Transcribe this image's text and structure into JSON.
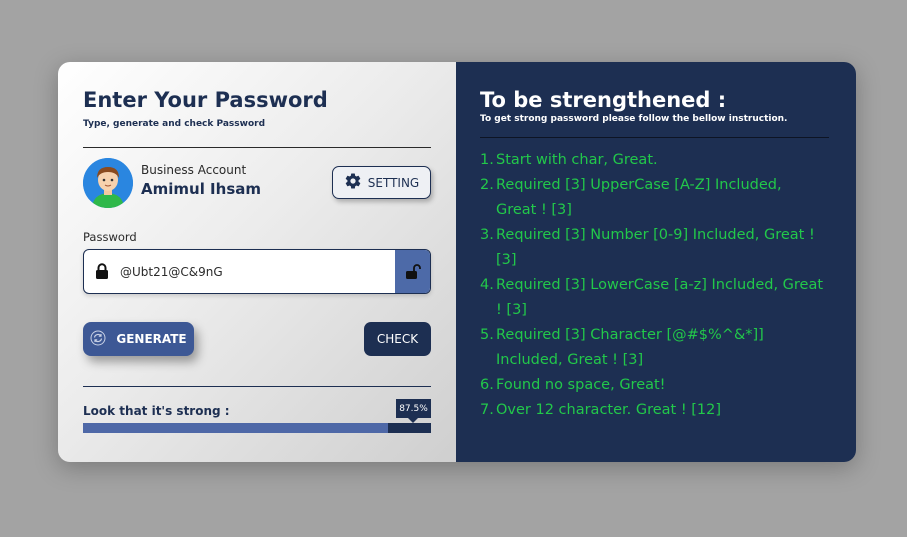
{
  "colors": {
    "navy": "#1d2f52",
    "accent_blue": "#3d5895",
    "success_green": "#22c84a",
    "page_background": "#a3a3a3"
  },
  "form": {
    "title": "Enter Your Password",
    "subtitle": "Type, generate and check Password",
    "account": {
      "avatar_icon": "user-avatar-icon",
      "type": "Business Account",
      "name": "Amimul Ihsam"
    },
    "setting_button": {
      "icon": "gear-icon",
      "label": "SETTING"
    },
    "password": {
      "label": "Password",
      "lock_icon": "lock-icon",
      "value": "@Ubt21@C&9nG",
      "toggle_icon": "unlock-icon"
    },
    "generate_button": {
      "icon": "refresh-icon",
      "label": "GENERATE"
    },
    "check_button": {
      "label": "CHECK"
    },
    "strength": {
      "label": "Look that it's strong :",
      "percent_text": "87.5%",
      "percent": 87.5
    }
  },
  "instructions": {
    "title": "To be strengthened :",
    "subtitle": "To get strong password please follow the bellow instruction.",
    "rules": [
      {
        "num": "1.",
        "text": "Start with char, Great."
      },
      {
        "num": "2.",
        "text": "Required [3] UpperCase [A-Z] Included, Great ! [3]"
      },
      {
        "num": "3.",
        "text": "Required [3] Number [0-9] Included, Great ! [3]"
      },
      {
        "num": "4.",
        "text": "Required [3] LowerCase [a-z] Included, Great ! [3]"
      },
      {
        "num": "5.",
        "text": "Required [3] Character [@#$%^&*]] Included, Great ! [3]"
      },
      {
        "num": "6.",
        "text": "Found no space, Great!"
      },
      {
        "num": "7.",
        "text": "Over 12 character. Great ! [12]"
      }
    ]
  }
}
